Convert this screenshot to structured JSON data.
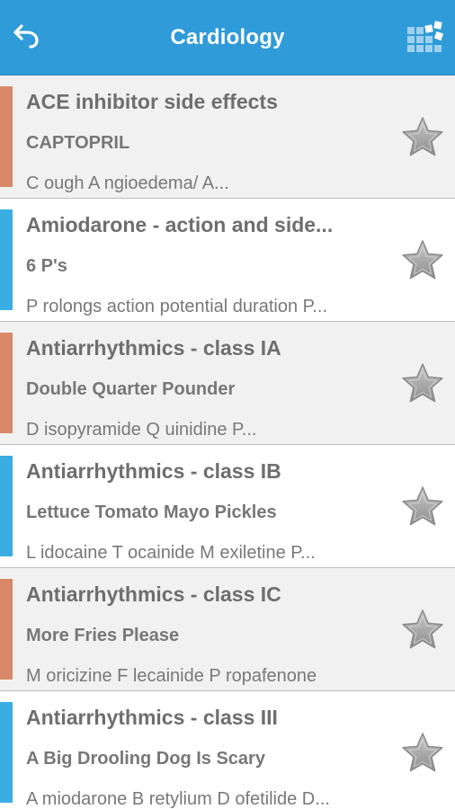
{
  "header": {
    "title": "Cardiology",
    "back_icon": "back-arrow-icon",
    "grid_icon": "grid-menu-icon",
    "color": "#2f9bd8"
  },
  "colors": {
    "orange": "#d9896a",
    "blue": "#3aaee2"
  },
  "items": [
    {
      "title": "ACE inhibitor side effects",
      "subtitle": "CAPTOPRIL",
      "preview": "C ough A ngioedema/ A...",
      "color": "orange"
    },
    {
      "title": "Amiodarone - action and side...",
      "subtitle": "6 P's",
      "preview": "P rolongs action potential duration P...",
      "color": "blue"
    },
    {
      "title": "Antiarrhythmics - class IA",
      "subtitle": "Double Quarter Pounder",
      "preview": "D isopyramide Q uinidine P...",
      "color": "orange"
    },
    {
      "title": "Antiarrhythmics - class IB",
      "subtitle": "Lettuce Tomato Mayo Pickles",
      "preview": "L idocaine T ocainide M exiletine P...",
      "color": "blue"
    },
    {
      "title": "Antiarrhythmics - class IC",
      "subtitle": "More Fries Please",
      "preview": "M oricizine F lecainide P ropafenone",
      "color": "orange"
    },
    {
      "title": "Antiarrhythmics - class III",
      "subtitle": "A Big Drooling Dog Is Scary",
      "preview": "A miodarone B retylium D ofetilide D...",
      "color": "blue"
    }
  ]
}
